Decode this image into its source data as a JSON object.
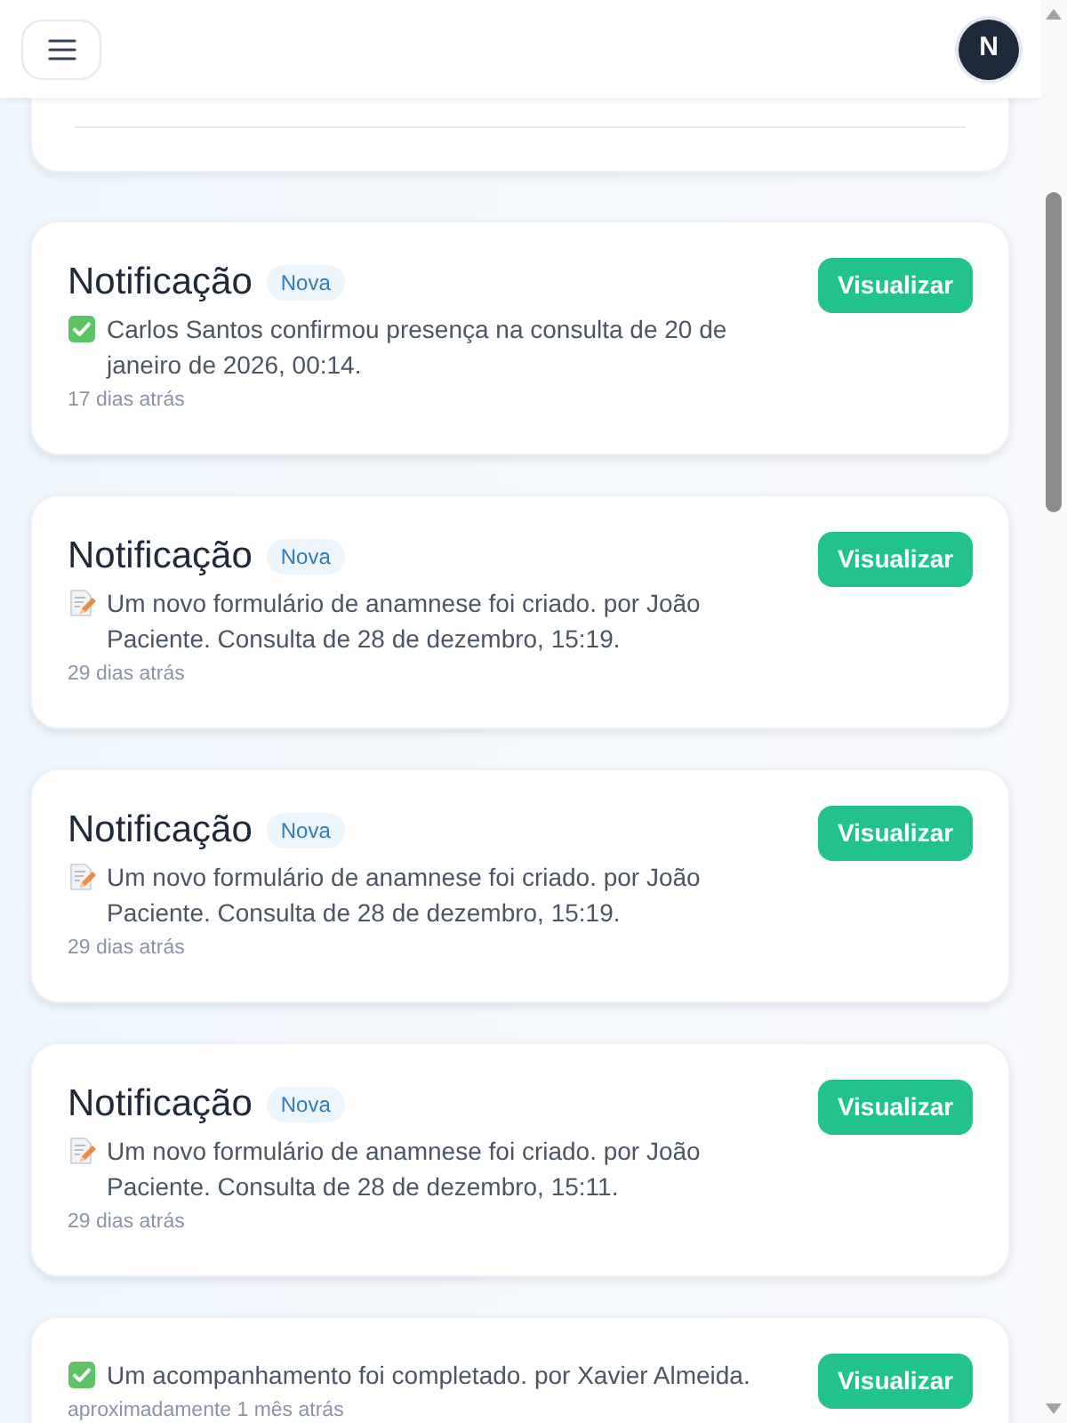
{
  "header": {
    "avatar_initial": "N"
  },
  "notifications": [
    {
      "kind": "confirmation",
      "title": "Notificação",
      "badge": "Nova",
      "message": "Carlos Santos confirmou presença na consulta de 20 de janeiro de 2026, 00:14.",
      "time": "17 dias atrás",
      "action": "Visualizar"
    },
    {
      "kind": "form",
      "title": "Notificação",
      "badge": "Nova",
      "message": "Um novo formulário de anamnese foi criado. por João Paciente. Consulta de 28 de dezembro, 15:19.",
      "time": "29 dias atrás",
      "action": "Visualizar"
    },
    {
      "kind": "form",
      "title": "Notificação",
      "badge": "Nova",
      "message": "Um novo formulário de anamnese foi criado. por João Paciente. Consulta de 28 de dezembro, 15:19.",
      "time": "29 dias atrás",
      "action": "Visualizar"
    },
    {
      "kind": "form",
      "title": "Notificação",
      "badge": "Nova",
      "message": "Um novo formulário de anamnese foi criado. por João Paciente. Consulta de 28 de dezembro, 15:11.",
      "time": "29 dias atrás",
      "action": "Visualizar"
    },
    {
      "kind": "confirmation",
      "message": "Um acompanhamento foi completado. por Xavier Almeida.",
      "time": "aproximadamente 1 mês atrás",
      "action": "Visualizar"
    }
  ]
}
